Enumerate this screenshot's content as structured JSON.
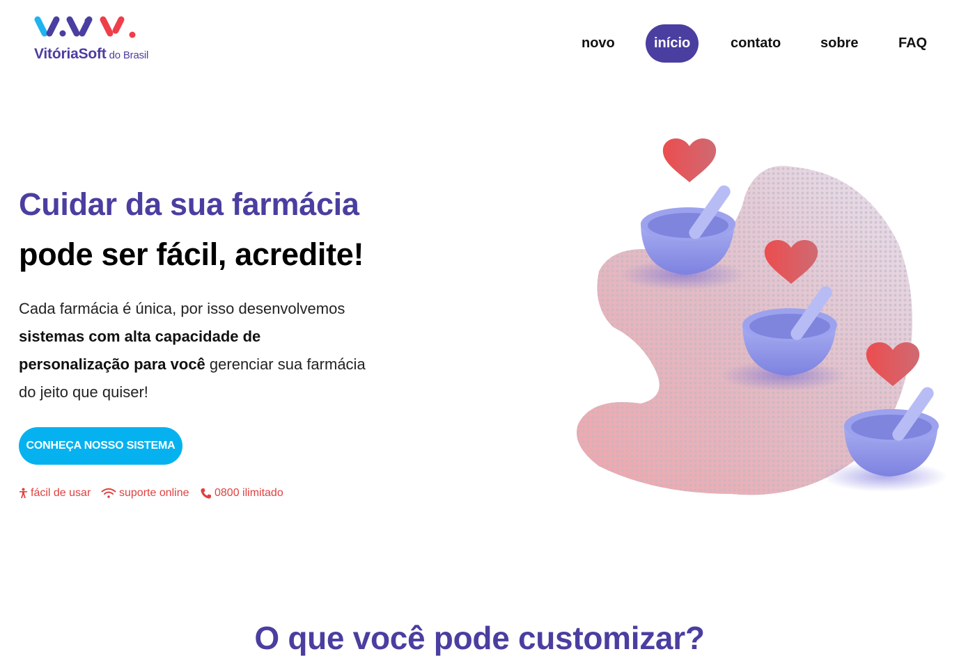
{
  "brand": {
    "name": "VitóriaSoft",
    "suffix": "do Brasil",
    "logo_colors": [
      "#1fb4ef",
      "#4a3ea0",
      "#ef3e4a"
    ]
  },
  "nav": {
    "items": [
      {
        "label": "novo",
        "active": false
      },
      {
        "label": "início",
        "active": true
      },
      {
        "label": "contato",
        "active": false
      },
      {
        "label": "sobre",
        "active": false
      },
      {
        "label": "FAQ",
        "active": false
      }
    ]
  },
  "hero": {
    "title": "Cuidar da sua farmácia",
    "subtitle": "pode ser fácil, acredite!",
    "desc_part1": "Cada farmácia é única, por isso desenvolvemos ",
    "desc_bold": "sistemas com alta capacidade de personalização para você",
    "desc_part2": " gerenciar sua farmácia do jeito que quiser!",
    "cta_label": "CONHEÇA NOSSO SISTEMA",
    "features": [
      {
        "icon": "accessibility-icon",
        "label": "fácil de usar"
      },
      {
        "icon": "wifi-icon",
        "label": "suporte online"
      },
      {
        "icon": "phone-icon",
        "label": "0800 ilimitado"
      }
    ]
  },
  "illustration": {
    "icons": [
      "heart-icon",
      "mortar-and-pestle-icon"
    ]
  },
  "section": {
    "title": "O que você pode customizar?"
  },
  "colors": {
    "primary": "#4a3ea0",
    "cta": "#05b2ef",
    "accent": "#e0403f"
  }
}
